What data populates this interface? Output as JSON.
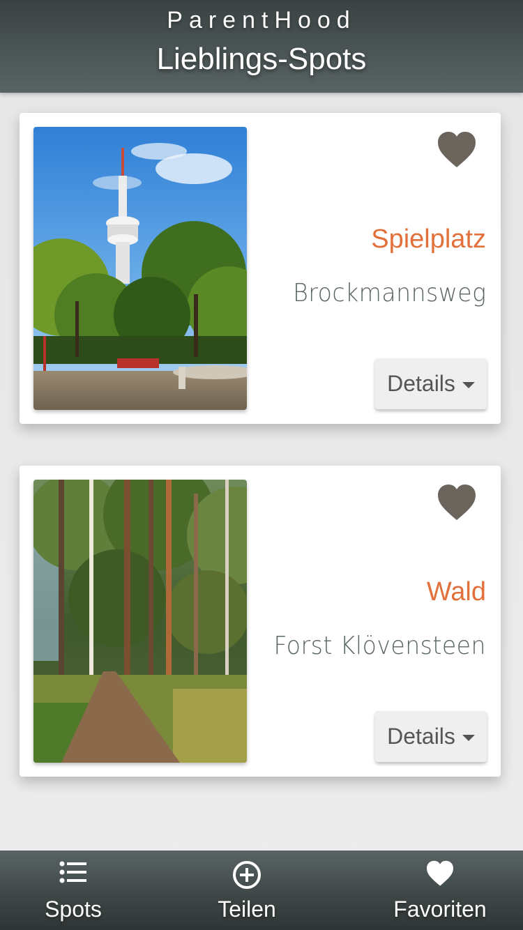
{
  "header": {
    "brand": "ParentHood",
    "title": "Lieblings-Spots"
  },
  "spots": [
    {
      "title": "Spielplatz",
      "subtitle": "Brockmannsweg",
      "details_label": "Details",
      "photo_icon": "tv-tower-park-photo",
      "favorite_icon": "heart-icon"
    },
    {
      "title": "Wald",
      "subtitle": "Forst Klövensteen",
      "details_label": "Details",
      "photo_icon": "forest-path-photo",
      "favorite_icon": "heart-icon"
    }
  ],
  "nav": {
    "items": [
      {
        "label": "Spots",
        "icon": "list-icon"
      },
      {
        "label": "Teilen",
        "icon": "plus-circle-icon"
      },
      {
        "label": "Favoriten",
        "icon": "heart-icon"
      }
    ]
  },
  "colors": {
    "accent": "#e2703a",
    "header_bg": "#4b5555",
    "heart": "#6b645d"
  }
}
